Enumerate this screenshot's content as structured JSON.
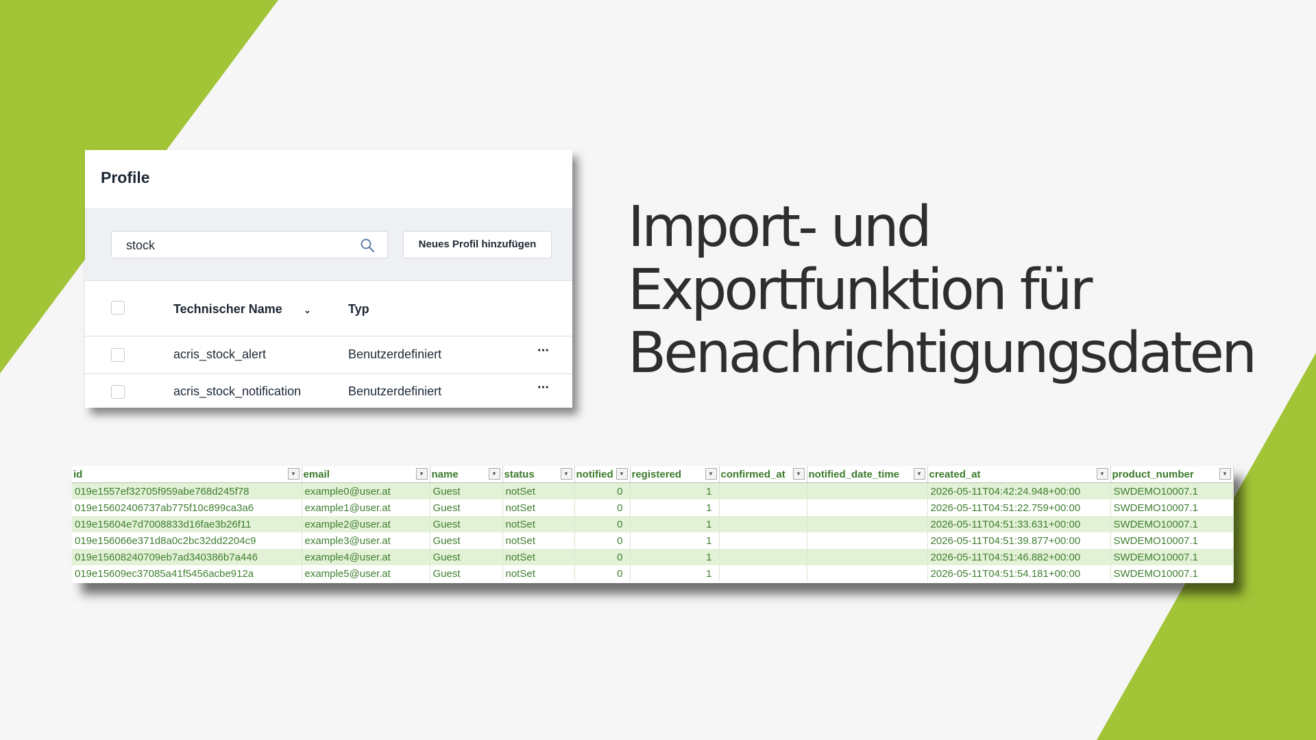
{
  "colors": {
    "accent_green": "#a2c437",
    "background": "#f6f6f6",
    "sheet_text": "#3f7f30"
  },
  "panel": {
    "title": "Profile",
    "search": {
      "value": "stock",
      "icon": "search-icon"
    },
    "add_button": "Neues Profil hinzufügen",
    "columns": {
      "name": "Technischer Name",
      "type": "Typ"
    },
    "rows": [
      {
        "name": "acris_stock_alert",
        "type": "Benutzerdefiniert",
        "more": "···"
      },
      {
        "name": "acris_stock_notification",
        "type": "Benutzerdefiniert",
        "more": "···"
      }
    ]
  },
  "headline": {
    "line1": "Import- und",
    "line2": "Exportfunktion für",
    "line3": "Benachrichtigungsdaten"
  },
  "sheet": {
    "headers": [
      "id",
      "email",
      "name",
      "status",
      "notified",
      "registered",
      "confirmed_at",
      "notified_date_time",
      "created_at",
      "product_number"
    ],
    "rows": [
      [
        "019e1557ef32705f959abe768d245f78",
        "example0@user.at",
        "Guest",
        "notSet",
        "0",
        "1",
        "",
        "",
        "2026-05-11T04:42:24.948+00:00",
        "SWDEMO10007.1"
      ],
      [
        "019e15602406737ab775f10c899ca3a6",
        "example1@user.at",
        "Guest",
        "notSet",
        "0",
        "1",
        "",
        "",
        "2026-05-11T04:51:22.759+00:00",
        "SWDEMO10007.1"
      ],
      [
        "019e15604e7d7008833d16fae3b26f11",
        "example2@user.at",
        "Guest",
        "notSet",
        "0",
        "1",
        "",
        "",
        "2026-05-11T04:51:33.631+00:00",
        "SWDEMO10007.1"
      ],
      [
        "019e156066e371d8a0c2bc32dd2204c9",
        "example3@user.at",
        "Guest",
        "notSet",
        "0",
        "1",
        "",
        "",
        "2026-05-11T04:51:39.877+00:00",
        "SWDEMO10007.1"
      ],
      [
        "019e15608240709eb7ad340386b7a446",
        "example4@user.at",
        "Guest",
        "notSet",
        "0",
        "1",
        "",
        "",
        "2026-05-11T04:51:46.882+00:00",
        "SWDEMO10007.1"
      ],
      [
        "019e15609ec37085a41f5456acbe912a",
        "example5@user.at",
        "Guest",
        "notSet",
        "0",
        "1",
        "",
        "",
        "2026-05-11T04:51:54.181+00:00",
        "SWDEMO10007.1"
      ]
    ]
  }
}
